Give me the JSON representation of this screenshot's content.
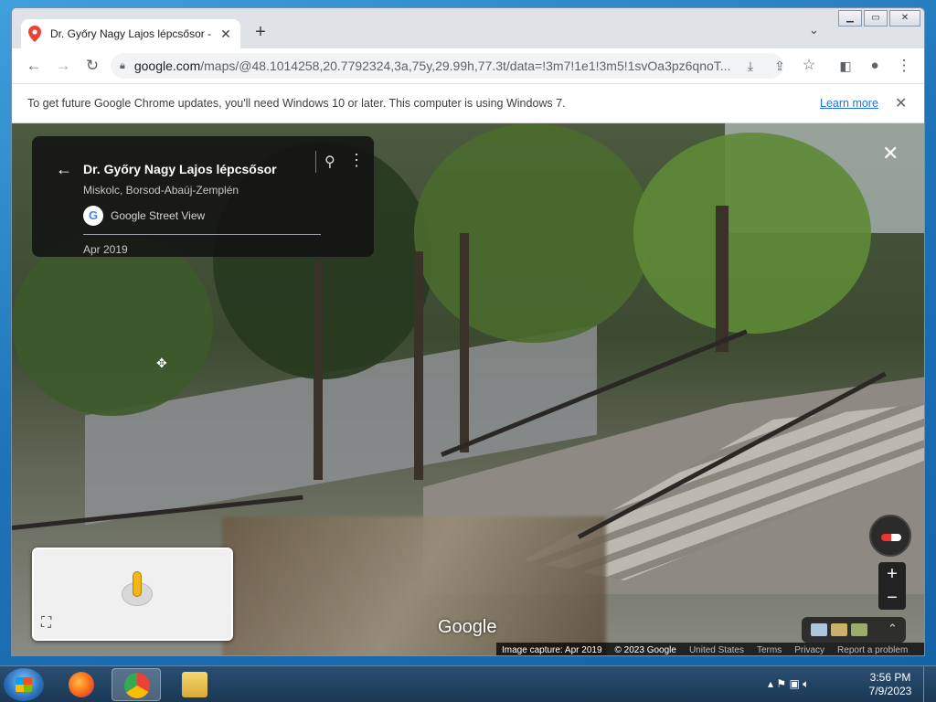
{
  "browser": {
    "tab_title": "Dr. Győry Nagy Lajos lépcsősor -",
    "new_tab_symbol": "+",
    "url_host": "google.com",
    "url_path": "/maps/@48.1014258,20.7792324,3a,75y,29.99h,77.3t/data=!3m7!1e1!3m5!1svOa3pz6qnoT..."
  },
  "infobar": {
    "message": "To get future Google Chrome updates, you'll need Windows 10 or later. This computer is using Windows 7.",
    "link": "Learn more"
  },
  "streetview": {
    "place_name": "Dr. Győry Nagy Lajos lépcsősor",
    "region": "Miskolc, Borsod-Abaúj-Zemplén",
    "source": "Google Street View",
    "date": "Apr 2019",
    "logo": "Google",
    "footer": {
      "capture": "Image capture: Apr 2019",
      "copyright": "© 2023 Google",
      "country": "United States",
      "terms": "Terms",
      "privacy": "Privacy",
      "report": "Report a problem"
    }
  },
  "taskbar": {
    "time": "3:56 PM",
    "date": "7/9/2023"
  },
  "colors": {
    "accent_link": "#1a73e8",
    "taskbar": "#1b3855"
  }
}
